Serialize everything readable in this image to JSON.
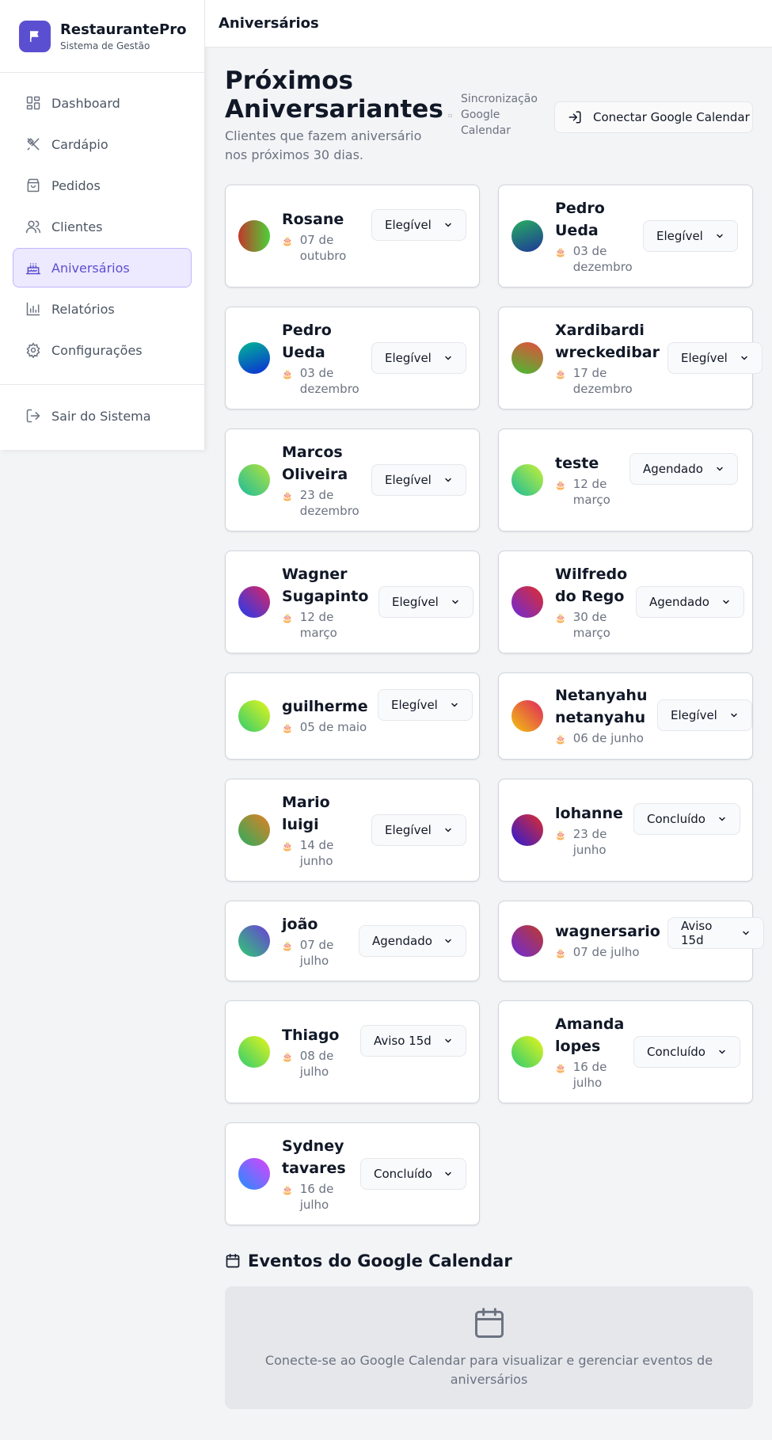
{
  "brand": {
    "name": "RestaurantePro",
    "subtitle": "Sistema de Gestão"
  },
  "sidebar": {
    "items": [
      {
        "label": "Dashboard",
        "icon": "dashboard-icon"
      },
      {
        "label": "Cardápio",
        "icon": "utensils-icon"
      },
      {
        "label": "Pedidos",
        "icon": "shopping-bag-icon"
      },
      {
        "label": "Clientes",
        "icon": "users-icon"
      },
      {
        "label": "Aniversários",
        "icon": "cake-icon",
        "active": true
      },
      {
        "label": "Relatórios",
        "icon": "bar-chart-icon"
      },
      {
        "label": "Configurações",
        "icon": "gear-icon"
      }
    ],
    "logout": "Sair do Sistema"
  },
  "topbar": {
    "title": "Aniversários"
  },
  "header": {
    "title": "Próximos Aniversariantes",
    "subtitle": "Clientes que fazem aniversário nos próximos 30 dias.",
    "sync_label": "Sincronização Google Calendar",
    "connect_label": "Conectar Google Calendar"
  },
  "customers": [
    {
      "name": "Rosane",
      "date": "07 de outubro",
      "status": "Elegível"
    },
    {
      "name": "Pedro Ueda",
      "date": "03 de dezembro",
      "status": "Elegível"
    },
    {
      "name": "Pedro Ueda",
      "date": "03 de dezembro",
      "status": "Elegível"
    },
    {
      "name": "Xardibardi wreckedibar",
      "date": "17 de dezembro",
      "status": "Elegível"
    },
    {
      "name": "Marcos Oliveira",
      "date": "23 de dezembro",
      "status": "Elegível"
    },
    {
      "name": "teste",
      "date": "12 de março",
      "status": "Agendado"
    },
    {
      "name": "Wagner Sugapinto",
      "date": "12 de março",
      "status": "Elegível"
    },
    {
      "name": "Wilfredo do Rego",
      "date": "30 de março",
      "status": "Agendado"
    },
    {
      "name": "guilherme",
      "date": "05 de maio",
      "status": "Elegível"
    },
    {
      "name": "Netanyahu netanyahu",
      "date": "06 de junho",
      "status": "Elegível"
    },
    {
      "name": "Mario luigi",
      "date": "14 de junho",
      "status": "Elegível"
    },
    {
      "name": "lohanne",
      "date": "23 de junho",
      "status": "Concluído"
    },
    {
      "name": "joão",
      "date": "07 de julho",
      "status": "Agendado"
    },
    {
      "name": "wagnersario",
      "date": "07 de julho",
      "status": "Aviso 15d"
    },
    {
      "name": "Thiago",
      "date": "08 de julho",
      "status": "Aviso 15d"
    },
    {
      "name": "Amanda lopes",
      "date": "16 de julho",
      "status": "Concluído"
    },
    {
      "name": "Sydney tavares",
      "date": "16 de julho",
      "status": "Concluído"
    }
  ],
  "events": {
    "title": "Eventos do Google Calendar",
    "empty_text": "Conecte-se ao Google Calendar para visualizar e gerenciar eventos de aniversários"
  },
  "colors": {
    "accent": "#5b4fd1",
    "active_bg": "#ede9fe"
  }
}
